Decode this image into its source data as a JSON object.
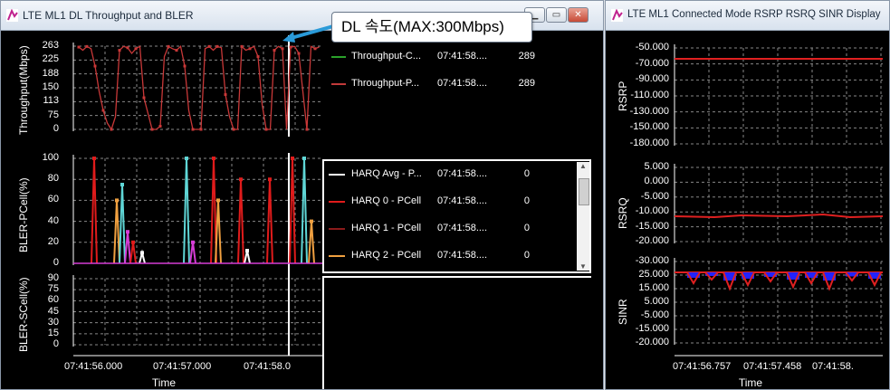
{
  "left_window": {
    "title": "LTE ML1 DL Throughput and BLER",
    "throughput": {
      "ylabel": "Throughput(Mbps)",
      "ticks": [
        "263",
        "225",
        "188",
        "150",
        "113",
        "75",
        "0"
      ],
      "legend": [
        {
          "name": "Throughput-C...",
          "time": "07:41:58....",
          "value": "289",
          "color": "#2aa12a"
        },
        {
          "name": "Throughput-P...",
          "time": "07:41:58....",
          "value": "289",
          "color": "#c23a3a"
        }
      ]
    },
    "bler_pcell": {
      "ylabel": "BLER-PCell(%)",
      "ticks": [
        "100",
        "80",
        "60",
        "40",
        "20",
        "0"
      ],
      "legend": [
        {
          "name": "HARQ Avg - P...",
          "time": "07:41:58....",
          "value": "0",
          "color": "#ffffff"
        },
        {
          "name": "HARQ 0 - PCell",
          "time": "07:41:58....",
          "value": "0",
          "color": "#e01b1b"
        },
        {
          "name": "HARQ 1 - PCell",
          "time": "07:41:58....",
          "value": "0",
          "color": "#8b1a1a"
        },
        {
          "name": "HARQ 2 - PCell",
          "time": "07:41:58....",
          "value": "0",
          "color": "#f0a040"
        }
      ]
    },
    "bler_scell": {
      "ylabel": "BLER-SCell(%)",
      "ticks": [
        "90",
        "75",
        "60",
        "45",
        "30",
        "15",
        "0"
      ]
    },
    "xticks": [
      "07:41:56.000",
      "07:41:57.000",
      "07:41:58.0"
    ],
    "xlabel": "Time"
  },
  "callout": {
    "text": "DL 속도(MAX:300Mbps)"
  },
  "right_window": {
    "title": "LTE ML1 Connected Mode RSRP RSRQ SINR Display",
    "rsrp": {
      "ylabel": "RSRP",
      "ticks": [
        "-50.000",
        "-70.000",
        "-90.000",
        "-110.000",
        "-130.000",
        "-150.000",
        "-180.000"
      ]
    },
    "rsrq": {
      "ylabel": "RSRQ",
      "ticks": [
        "5.000",
        "0.000",
        "-5.000",
        "-10.000",
        "-15.000",
        "-20.000"
      ]
    },
    "sinr": {
      "ylabel": "SINR",
      "ticks": [
        "-30.000",
        "25.000",
        "15.000",
        "5.000",
        "-5.000",
        "-15.000",
        "-20.000"
      ]
    },
    "xticks": [
      "07:41:56.757",
      "07:41:57.458",
      "07:41:58."
    ],
    "xlabel": "Time"
  },
  "colors": {
    "throughput": "#c83838",
    "harq0": "#e01b1b",
    "cyan": "#5fd6d6",
    "magenta": "#d63cd6",
    "rsrp": "#e02020",
    "sinr_blue": "#2222ff"
  }
}
